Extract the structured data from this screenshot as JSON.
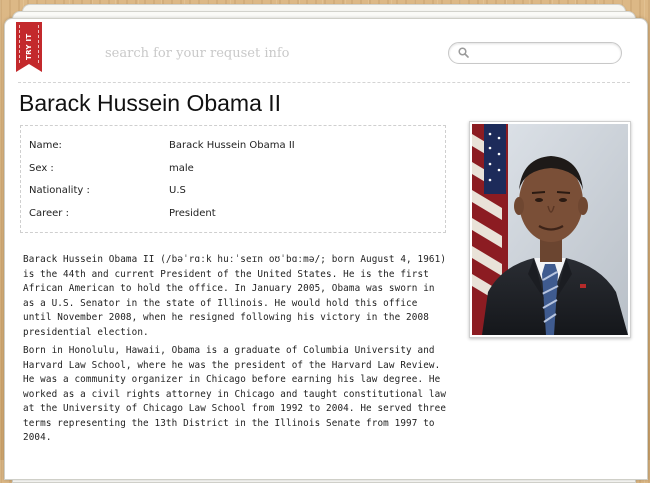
{
  "tab": {
    "label": "TRY IT"
  },
  "search": {
    "hint": "search for your requset info",
    "value": "",
    "placeholder": ""
  },
  "person": {
    "title": "Barack Hussein Obama II",
    "fields": [
      {
        "label": "Name:",
        "value": "Barack Hussein Obama II"
      },
      {
        "label": "Sex :",
        "value": "male"
      },
      {
        "label": "Nationality :",
        "value": "U.S"
      },
      {
        "label": "Career :",
        "value": "President"
      }
    ],
    "bio": [
      "Barack Hussein Obama II (/bəˈrɑːk huːˈseɪn oʊˈbɑːmə/; born August 4, 1961) is the 44th and current President of the United States. He is the first African American to hold the office. In January 2005, Obama was sworn in as a U.S. Senator in the state of Illinois. He would hold this office until November 2008, when he resigned following his victory in the 2008 presidential election.",
      "Born in Honolulu, Hawaii, Obama is a graduate of Columbia University and Harvard Law School, where he was the president of the Harvard Law Review. He was a community organizer in Chicago before earning his law degree. He worked as a civil rights attorney in Chicago and taught constitutional law at the University of Chicago Law School from 1992 to 2004. He served three terms representing the 13th District in the Illinois Senate from 1997 to 2004."
    ]
  },
  "icons": {
    "search": "magnifier-icon",
    "photo": "portrait-photo"
  },
  "colors": {
    "bookmark": "#c3292c",
    "wood": "#d8b37e",
    "paper": "#ffffff"
  }
}
